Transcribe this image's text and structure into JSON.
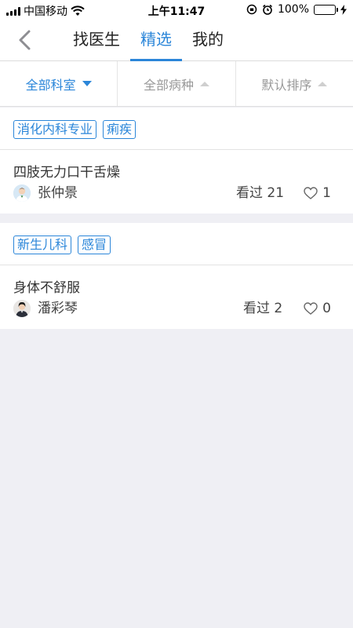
{
  "status_bar": {
    "carrier": "中国移动",
    "time": "上午11:47",
    "battery_percent": "100%",
    "battery_level": 1.0
  },
  "nav": {
    "tabs": [
      {
        "label": "找医生",
        "active": false
      },
      {
        "label": "精选",
        "active": true
      },
      {
        "label": "我的",
        "active": false
      }
    ]
  },
  "filters": [
    {
      "label": "全部科室",
      "active": true
    },
    {
      "label": "全部病种",
      "active": false
    },
    {
      "label": "默认排序",
      "active": false
    }
  ],
  "posts": [
    {
      "tags": [
        "消化内科专业",
        "痢疾"
      ],
      "title": "四肢无力口干舌燥",
      "author": "张仲景",
      "views": "看过 21",
      "likes": "1"
    },
    {
      "tags": [
        "新生儿科",
        "感冒"
      ],
      "title": "身体不舒服",
      "author": "潘彩琴",
      "views": "看过 2",
      "likes": "0"
    }
  ],
  "colors": {
    "accent": "#2b86d9",
    "background": "#efeff4",
    "battery": "#4cd964"
  },
  "icons": {
    "back": "chevron-left-icon",
    "like": "heart-outline-icon",
    "dropdown": "triangle-icon"
  }
}
